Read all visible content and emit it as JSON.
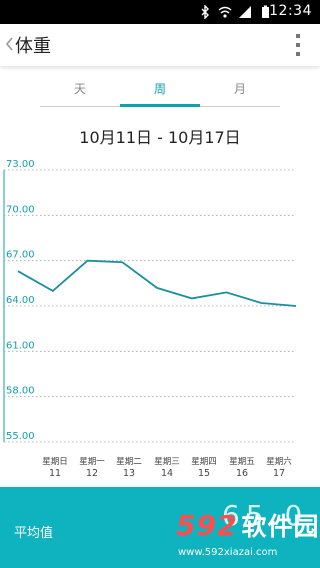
{
  "status_bar": {
    "time": "12:34",
    "icons": [
      "bluetooth-icon",
      "wifi-icon",
      "signal-icon",
      "battery-icon"
    ]
  },
  "app_bar": {
    "title": "体重",
    "back_icon": "chevron-left-icon",
    "menu_icon": "overflow-menu-icon"
  },
  "tabs": [
    {
      "label": "天",
      "active": false
    },
    {
      "label": "周",
      "active": true
    },
    {
      "label": "月",
      "active": false
    }
  ],
  "date_range": "10月11日 - 10月17日",
  "colors": {
    "accent": "#11a0b0",
    "bottom_bar": "#0fb2bf",
    "line": "#1a8fa0"
  },
  "chart_data": {
    "type": "line",
    "title": "",
    "xlabel": "",
    "ylabel": "",
    "ylim": [
      55,
      73
    ],
    "y_ticks": [
      "73.00",
      "70.00",
      "67.00",
      "64.00",
      "61.00",
      "58.00",
      "55.00"
    ],
    "grid": true,
    "categories": [
      {
        "day": "星期日",
        "date": "11"
      },
      {
        "day": "星期一",
        "date": "12"
      },
      {
        "day": "星期二",
        "date": "13"
      },
      {
        "day": "星期三",
        "date": "14"
      },
      {
        "day": "星期四",
        "date": "15"
      },
      {
        "day": "星期五",
        "date": "16"
      },
      {
        "day": "星期六",
        "date": "17"
      }
    ],
    "series": [
      {
        "points": [
          {
            "x": "10",
            "y": 66.3
          },
          {
            "x": "11",
            "y": 65.0
          },
          {
            "x": "12",
            "y": 67.0
          },
          {
            "x": "13",
            "y": 66.9
          },
          {
            "x": "14",
            "y": 65.2
          },
          {
            "x": "15",
            "y": 64.5
          },
          {
            "x": "16",
            "y": 64.9
          },
          {
            "x": "17",
            "y": 64.2
          },
          {
            "x": "18",
            "y": 64.0
          }
        ]
      }
    ]
  },
  "bottom": {
    "avg_label": "平均值",
    "avg_value": "65.0"
  },
  "watermark": {
    "logo_num": "592",
    "logo_cn": "软件园",
    "url": "www.592xiazai.com"
  }
}
